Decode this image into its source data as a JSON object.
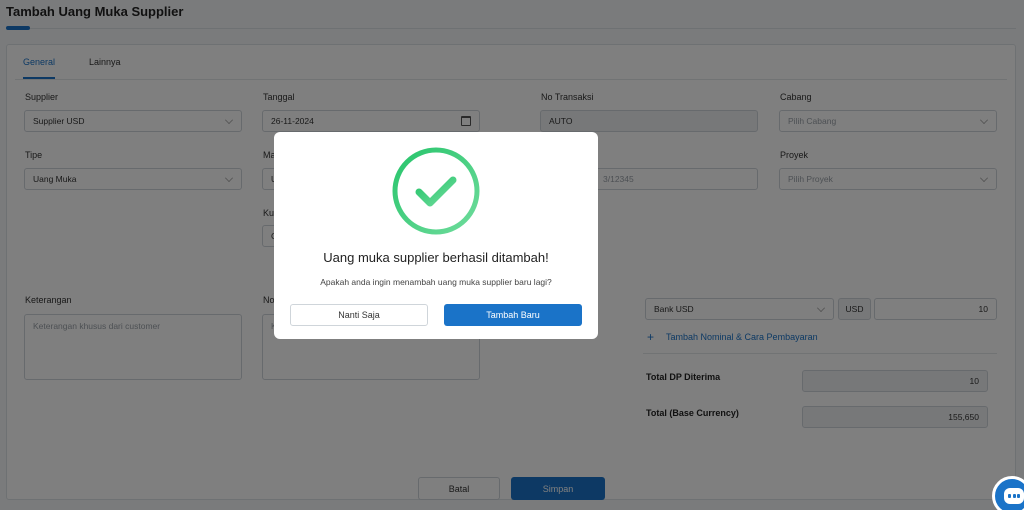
{
  "page": {
    "title": "Tambah Uang Muka Supplier"
  },
  "tabs": [
    {
      "label": "General"
    },
    {
      "label": "Lainnya"
    }
  ],
  "form": {
    "supplier": {
      "label": "Supplier",
      "value": "Supplier USD"
    },
    "tanggal": {
      "label": "Tanggal",
      "value": "26-11-2024"
    },
    "no_transaksi": {
      "label": "No Transaksi",
      "value": "AUTO"
    },
    "cabang": {
      "label": "Cabang",
      "placeholder": "Pilih Cabang"
    },
    "tipe": {
      "label": "Tipe",
      "value": "Uang Muka"
    },
    "ma_label_partial": "Ma",
    "u_value_partial": "U",
    "ref_partial_value": "3/12345",
    "proyek": {
      "label": "Proyek",
      "placeholder": "Pilih Proyek"
    },
    "ku_label_partial": "Ku",
    "c_value_partial": "C",
    "keterangan": {
      "label": "Keterangan",
      "placeholder": "Keterangan khusus dari customer"
    },
    "no_label_partial": "No",
    "v_placeholder_partial": "K"
  },
  "payment": {
    "bank": "Bank USD",
    "currency": "USD",
    "amount": "10",
    "add_label": "Tambah Nominal & Cara Pembayaran",
    "total_dp_label": "Total DP Diterima",
    "total_dp_value": "10",
    "total_base_label": "Total (Base Currency)",
    "total_base_value": "155,650"
  },
  "actions": {
    "batal": "Batal",
    "simpan": "Simpan"
  },
  "modal": {
    "title": "Uang muka supplier berhasil ditambah!",
    "subtitle": "Apakah anda ingin menambah uang muka supplier baru lagi?",
    "later_label": "Nanti Saja",
    "new_label": "Tambah Baru"
  },
  "colors": {
    "accent": "#1a73c8",
    "success": "#2ecc71"
  }
}
